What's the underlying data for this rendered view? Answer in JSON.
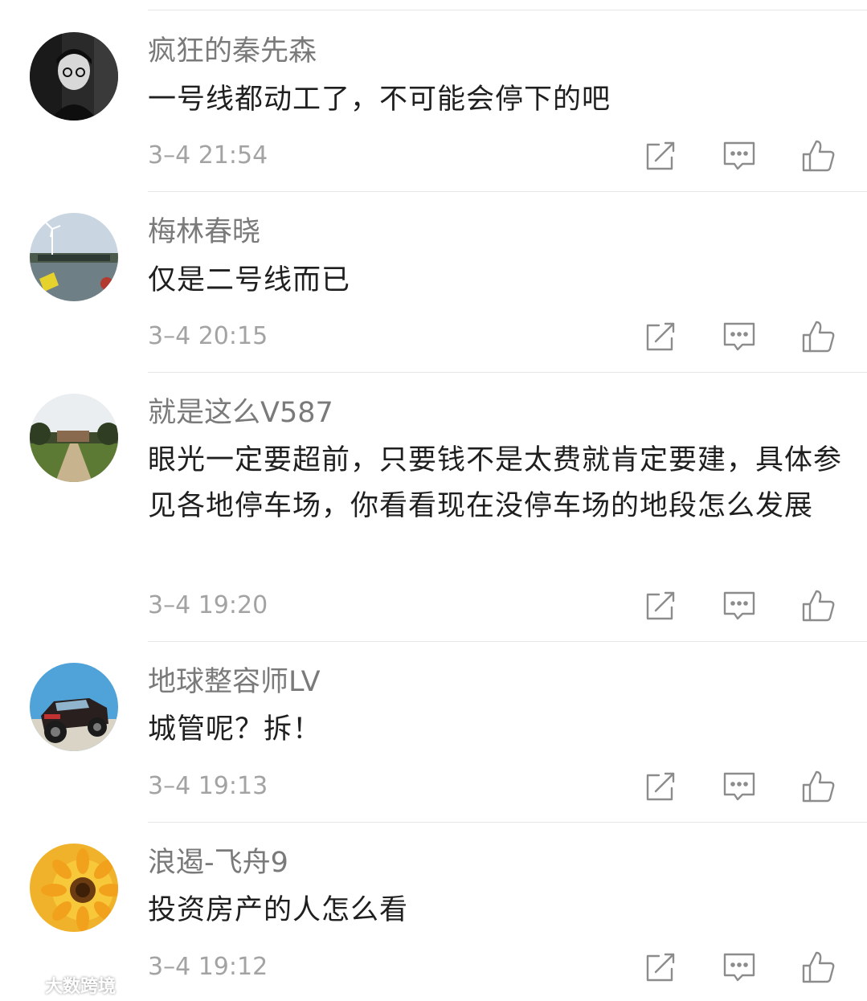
{
  "comments": [
    {
      "username": "疯狂的秦先森",
      "content": "一号线都动工了，不可能会停下的吧",
      "time": "3–4 21:54",
      "avatar_icon": "person-portrait-avatar"
    },
    {
      "username": "梅林春晓",
      "content": "仅是二号线而已",
      "time": "3–4 20:15",
      "avatar_icon": "wind-turbine-river-avatar"
    },
    {
      "username": "就是这么V587",
      "content": "眼光一定要超前，只要钱不是太费就肯定要建，具体参见各地停车场，你看看现在没停车场的地段怎么发展",
      "time": "3–4 19:20",
      "avatar_icon": "park-path-avatar"
    },
    {
      "username": "地球整容师LV",
      "content": "城管呢？拆！",
      "time": "3–4 19:13",
      "avatar_icon": "offroad-car-avatar"
    },
    {
      "username": "浪遏-飞舟9",
      "content": "投资房产的人怎么看",
      "time": "3–4 19:12",
      "avatar_icon": "sunflower-avatar"
    }
  ],
  "actions": {
    "share_icon": "share-icon",
    "reply_icon": "reply-icon",
    "like_icon": "thumbs-up-icon"
  },
  "watermark": {
    "text": "大数跨境"
  },
  "colors": {
    "username": "#7a7a7a",
    "content": "#1f1f1f",
    "time": "#a3a3a3",
    "icon": "#8c8c8c",
    "divider": "#e6e6e6"
  }
}
